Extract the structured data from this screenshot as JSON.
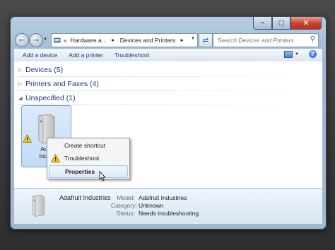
{
  "window": {
    "controls": {
      "minimize": "–",
      "maximize": "□",
      "close": "✕"
    }
  },
  "nav": {
    "back_icon": "back-arrow-icon",
    "forward_icon": "forward-arrow-icon",
    "address": {
      "overflow": "«",
      "crumbs": [
        "Hardware a...",
        "Devices and Printers"
      ]
    },
    "search_placeholder": "Search Devices and Printers"
  },
  "commands": {
    "add_device": "Add a device",
    "add_printer": "Add a printer",
    "troubleshoot": "Troubleshoot"
  },
  "groups": [
    {
      "label": "Devices (5)",
      "expanded": false
    },
    {
      "label": "Printers and Faxes (4)",
      "expanded": false
    },
    {
      "label": "Unspecified (1)",
      "expanded": true
    }
  ],
  "device": {
    "label": "Adafruit Industries",
    "label_visible": "Adaf\nIndus",
    "status_icon": "warning-icon"
  },
  "context_menu": {
    "items": [
      {
        "label": "Create shortcut"
      },
      {
        "label": "Troubleshoot",
        "icon": "warning-icon"
      },
      {
        "label": "Properties",
        "highlighted": true
      }
    ]
  },
  "details": {
    "name": "Adafruit Industries",
    "labels": [
      "Model:",
      "Category:",
      "Status:"
    ],
    "values": [
      "Adafruit Industries",
      "Unknown",
      "Needs troubleshooting"
    ]
  },
  "colors": {
    "group_text": "#1e3287",
    "selection": "#c1dbf6",
    "close_button": "#c7422d"
  }
}
